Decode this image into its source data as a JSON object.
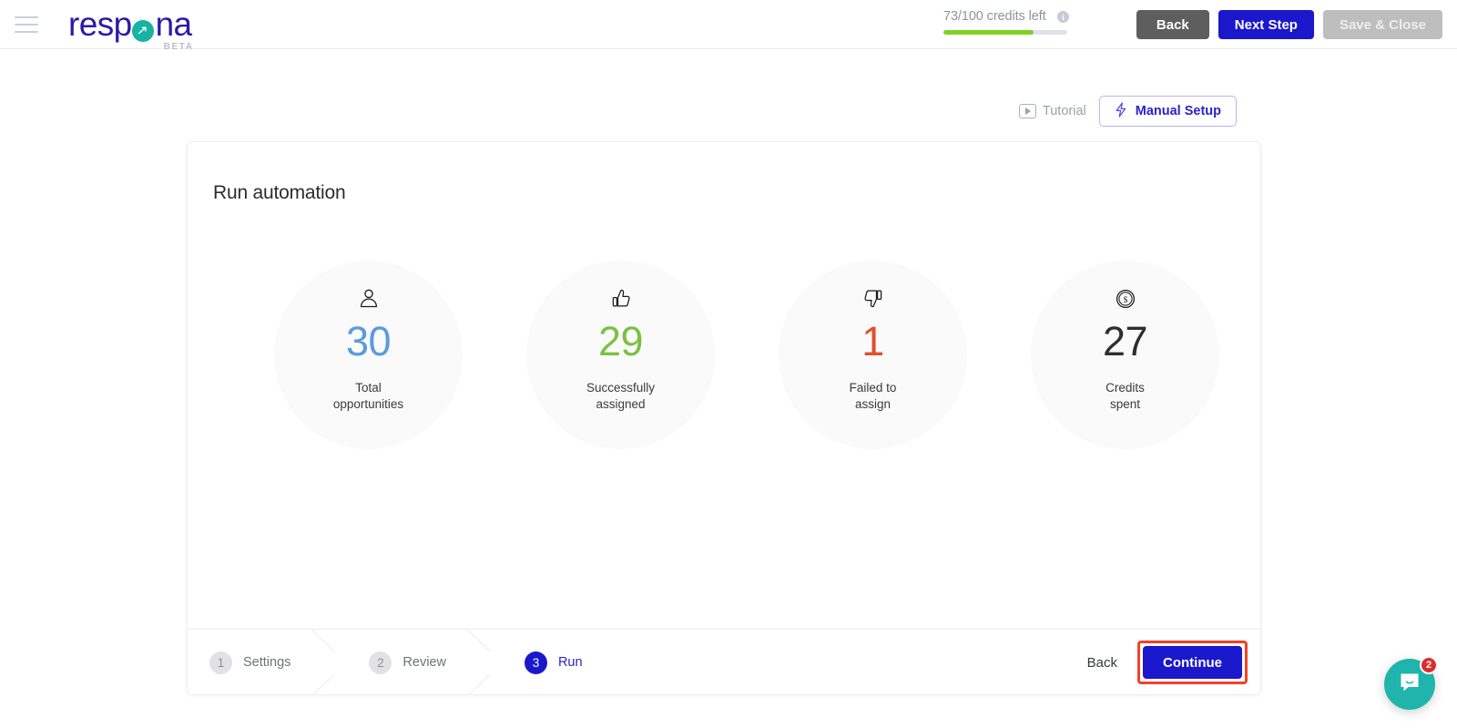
{
  "header": {
    "menu_icon": "hamburger-menu-icon",
    "logo": {
      "text_left": "resp",
      "text_right": "na",
      "badge": "BETA"
    },
    "credits": {
      "text": "73/100 credits left",
      "used": 73,
      "total": 100,
      "percent": 73,
      "fill_color": "#7ed321",
      "track_color": "#dfe3e8",
      "info_icon": "i"
    },
    "buttons": {
      "back": "Back",
      "next_step": "Next Step",
      "save_close": "Save & Close"
    }
  },
  "toolbar": {
    "tutorial_label": "Tutorial",
    "tutorial_icon": "play-icon",
    "manual_setup_label": "Manual Setup",
    "manual_setup_icon": "lightning-bolt-icon"
  },
  "card": {
    "title": "Run automation",
    "stats": [
      {
        "value": "30",
        "label_line1": "Total",
        "label_line2": "opportunities",
        "color": "#5b9bdd",
        "icon": "person-icon"
      },
      {
        "value": "29",
        "label_line1": "Successfully",
        "label_line2": "assigned",
        "color": "#7ac143",
        "icon": "thumbs-up-icon"
      },
      {
        "value": "1",
        "label_line1": "Failed to",
        "label_line2": "assign",
        "color": "#e04e2a",
        "icon": "thumbs-down-icon"
      },
      {
        "value": "27",
        "label_line1": "Credits",
        "label_line2": "spent",
        "color": "#2e2e2e",
        "icon": "coin-dollar-icon"
      }
    ]
  },
  "footer": {
    "steps": [
      {
        "num": "1",
        "label": "Settings",
        "active": false
      },
      {
        "num": "2",
        "label": "Review",
        "active": false
      },
      {
        "num": "3",
        "label": "Run",
        "active": true
      }
    ],
    "back_label": "Back",
    "continue_label": "Continue",
    "highlight_color": "#f2412a"
  },
  "intercom": {
    "badge_count": "2",
    "icon": "chat-bubble-icon",
    "color": "#1fb4ac"
  }
}
